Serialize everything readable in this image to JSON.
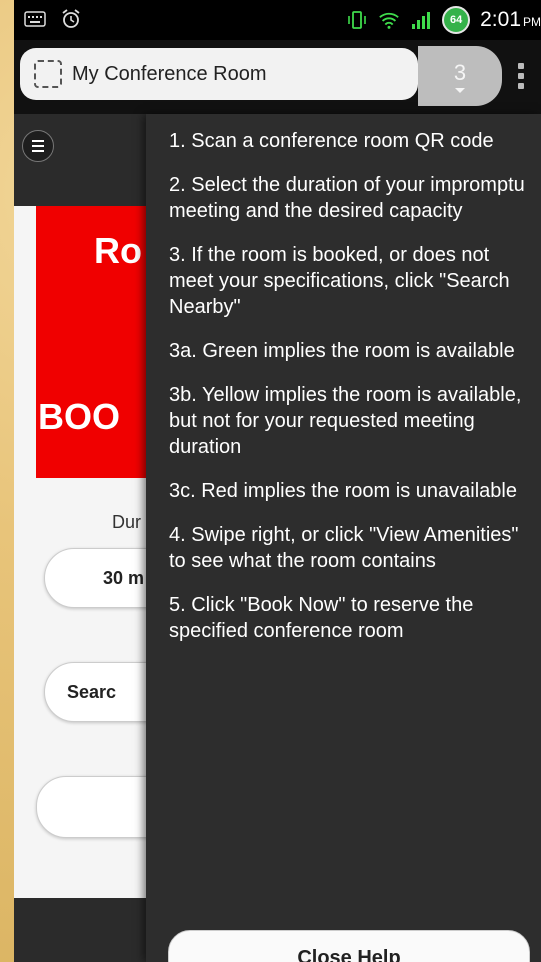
{
  "statusbar": {
    "time": "2:01",
    "ampm": "PM",
    "battery": "64"
  },
  "browser": {
    "url_title": "My Conference Room",
    "tab_count": "3"
  },
  "app": {
    "room_name": "Ro",
    "room_status": "BOO",
    "duration_label": "Dur",
    "duration_button": "30 m",
    "search_button": "Searc"
  },
  "help": {
    "items": [
      "1. Scan a conference room QR code",
      "2. Select the duration of your impromptu meeting and the desired capacity",
      "3. If the room is booked, or does not meet your specifications, click \"Search Nearby\"",
      "3a. Green implies the room is available",
      "3b. Yellow implies the room is available, but not for your requested meeting duration",
      "3c. Red implies the room is unavailable",
      "4. Swipe right, or click \"View Amenities\" to see what the room contains",
      "5. Click \"Book Now\" to reserve the specified conference room"
    ],
    "close_label": "Close Help"
  },
  "colors": {
    "status_red": "#f00000",
    "battery_green": "#35b24a",
    "panel_dark": "#2d2d2d"
  },
  "icons": [
    "keyboard-icon",
    "alarm-icon",
    "vibrate-icon",
    "wifi-icon",
    "signal-icon",
    "menu-icon",
    "tabs-icon"
  ]
}
